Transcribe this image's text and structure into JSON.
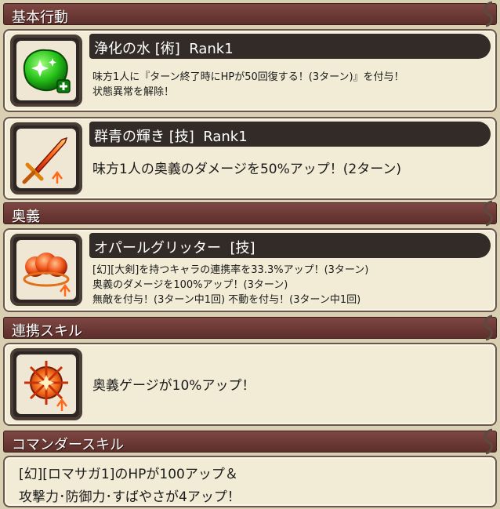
{
  "sections": {
    "basic": {
      "title": "基本行動"
    },
    "ougi": {
      "title": "奥義"
    },
    "renkei": {
      "title": "連携スキル"
    },
    "commander": {
      "title": "コマンダースキル"
    }
  },
  "skills": {
    "joka": {
      "name": "浄化の水 [術]",
      "rank": "Rank1",
      "desc_line1": "味方1人に『ターン終了時にHPが50回復する！(3ターン)』を付与！",
      "desc_line2": "状態異常を解除！",
      "icon": "green-sparkle-drop-icon"
    },
    "gunjo": {
      "name": "群青の輝き [技]",
      "rank": "Rank1",
      "desc_line1": "味方1人の奥義のダメージを50%アップ！(2ターン)",
      "icon": "flaming-sword-icon"
    },
    "opal": {
      "name": "オパールグリッター",
      "type": "[技]",
      "desc_line1": "[幻][大剣]を持つキャラの連携率を33.3%アップ！(3ターン)",
      "desc_line2": "奥義のダメージを100%アップ！(3ターン)",
      "desc_line3": "無敵を付与！(3ターン中1回) 不動を付与！(3ターン中1回)",
      "icon": "orange-orbs-icon"
    },
    "renkei": {
      "desc_line1": "奥義ゲージが10%アップ！",
      "icon": "orange-compass-icon"
    }
  },
  "commander": {
    "line1": "[幻][ロマサガ1]のHPが100アップ＆",
    "line2": "攻撃力･防御力･すばやさが4アップ！"
  },
  "colors": {
    "background": "#d9cfb2",
    "header": "#6a3834",
    "card": "#f2ecd6",
    "name_bar": "#322b28"
  }
}
